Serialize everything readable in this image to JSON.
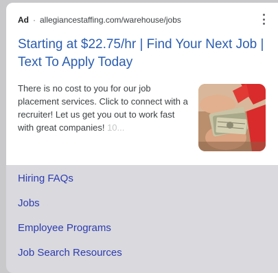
{
  "ad": {
    "label": "Ad",
    "separator": "·",
    "url": "allegiancestaffing.com/warehouse/jobs",
    "headline": "Starting at $22.75/hr | Find Your Next Job | Text To Apply Today",
    "description": "There is no cost to you for our job placement services. Click to connect with a recruiter! Let us get you out to work fast with great companies!",
    "description_faded": "10...",
    "menu_icon": "more-vert-icon",
    "thumbnail": "cash-hands-image"
  },
  "sitelinks": [
    {
      "label": "Hiring FAQs"
    },
    {
      "label": "Jobs"
    },
    {
      "label": "Employee Programs"
    },
    {
      "label": "Job Search Resources"
    }
  ],
  "colors": {
    "headline": "#2a5db0",
    "sitelink": "#2c3bb0",
    "page_bg": "#c9c9cb",
    "card_bg": "#d9d9de"
  }
}
